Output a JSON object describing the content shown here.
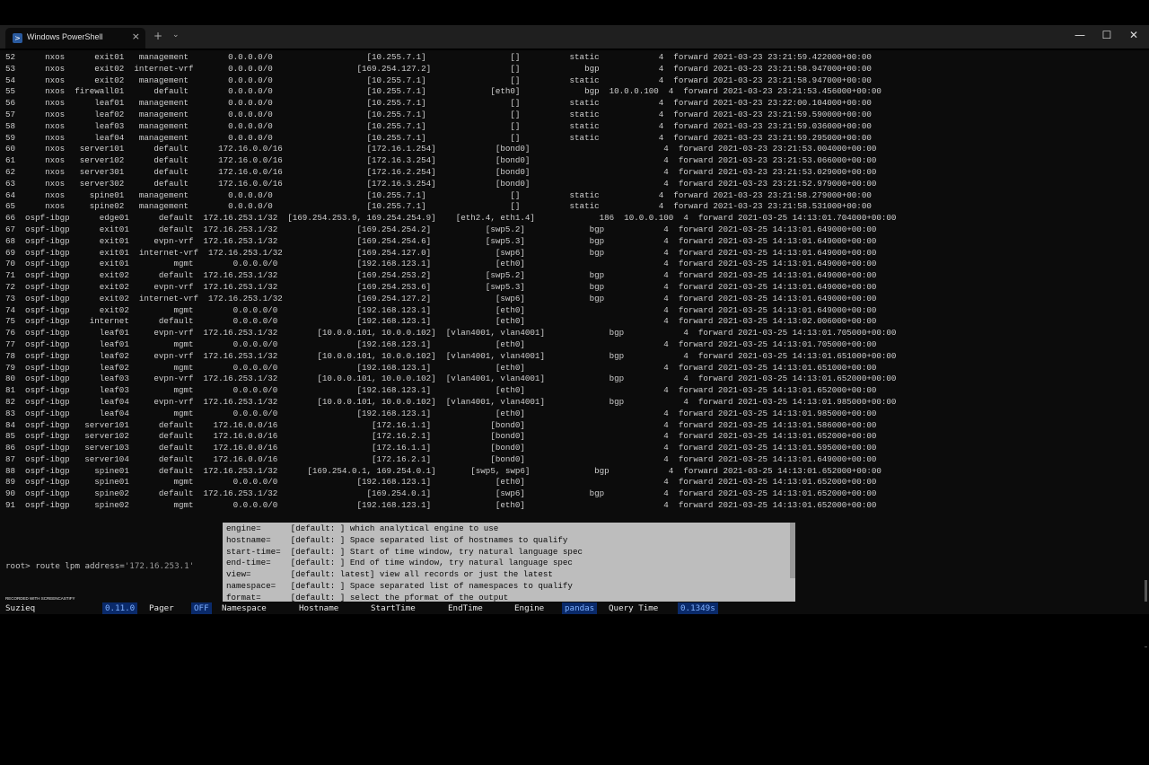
{
  "window": {
    "tab_title": "Windows PowerShell",
    "tab_close": "×",
    "new_tab": "+",
    "dropdown": "⌄",
    "minimize": "—",
    "maximize": "☐",
    "close": "✕"
  },
  "terminal_lines": [
    "52      nxos      exit01   management        0.0.0.0/0                   [10.255.7.1]                 []          static            4  forward 2021-03-23 23:21:59.422000+00:00",
    "53      nxos      exit02  internet-vrf       0.0.0.0/0                 [169.254.127.2]                []             bgp            4  forward 2021-03-23 23:21:58.947000+00:00",
    "54      nxos      exit02   management        0.0.0.0/0                   [10.255.7.1]                 []          static            4  forward 2021-03-23 23:21:58.947000+00:00",
    "55      nxos  firewall01      default        0.0.0.0/0                   [10.255.7.1]             [eth0]             bgp  10.0.0.100  4  forward 2021-03-23 23:21:53.456000+00:00",
    "56      nxos      leaf01   management        0.0.0.0/0                   [10.255.7.1]                 []          static            4  forward 2021-03-23 23:22:00.104000+00:00",
    "57      nxos      leaf02   management        0.0.0.0/0                   [10.255.7.1]                 []          static            4  forward 2021-03-23 23:21:59.590000+00:00",
    "58      nxos      leaf03   management        0.0.0.0/0                   [10.255.7.1]                 []          static            4  forward 2021-03-23 23:21:59.036000+00:00",
    "59      nxos      leaf04   management        0.0.0.0/0                   [10.255.7.1]                 []          static            4  forward 2021-03-23 23:21:59.295000+00:00",
    "60      nxos   server101      default      172.16.0.0/16                 [172.16.1.254]            [bond0]                           4  forward 2021-03-23 23:21:53.004000+00:00",
    "61      nxos   server102      default      172.16.0.0/16                 [172.16.3.254]            [bond0]                           4  forward 2021-03-23 23:21:53.066000+00:00",
    "62      nxos   server301      default      172.16.0.0/16                 [172.16.2.254]            [bond0]                           4  forward 2021-03-23 23:21:53.029000+00:00",
    "63      nxos   server302      default      172.16.0.0/16                 [172.16.3.254]            [bond0]                           4  forward 2021-03-23 23:21:52.979000+00:00",
    "64      nxos     spine01   management        0.0.0.0/0                   [10.255.7.1]                 []          static            4  forward 2021-03-23 23:21:58.279000+00:00",
    "65      nxos     spine02   management        0.0.0.0/0                   [10.255.7.1]                 []          static            4  forward 2021-03-23 23:21:58.531000+00:00",
    "66  ospf-ibgp      edge01      default  172.16.253.1/32  [169.254.253.9, 169.254.254.9]    [eth2.4, eth1.4]             186  10.0.0.100  4  forward 2021-03-25 14:13:01.704000+00:00",
    "67  ospf-ibgp      exit01      default  172.16.253.1/32                [169.254.254.2]           [swp5.2]             bgp            4  forward 2021-03-25 14:13:01.649000+00:00",
    "68  ospf-ibgp      exit01     evpn-vrf  172.16.253.1/32                [169.254.254.6]           [swp5.3]             bgp            4  forward 2021-03-25 14:13:01.649000+00:00",
    "69  ospf-ibgp      exit01  internet-vrf  172.16.253.1/32               [169.254.127.0]             [swp6]             bgp            4  forward 2021-03-25 14:13:01.649000+00:00",
    "70  ospf-ibgp      exit01         mgmt        0.0.0.0/0                [192.168.123.1]             [eth0]                            4  forward 2021-03-25 14:13:01.649000+00:00",
    "71  ospf-ibgp      exit02      default  172.16.253.1/32                [169.254.253.2]           [swp5.2]             bgp            4  forward 2021-03-25 14:13:01.649000+00:00",
    "72  ospf-ibgp      exit02     evpn-vrf  172.16.253.1/32                [169.254.253.6]           [swp5.3]             bgp            4  forward 2021-03-25 14:13:01.649000+00:00",
    "73  ospf-ibgp      exit02  internet-vrf  172.16.253.1/32               [169.254.127.2]             [swp6]             bgp            4  forward 2021-03-25 14:13:01.649000+00:00",
    "74  ospf-ibgp      exit02         mgmt        0.0.0.0/0                [192.168.123.1]             [eth0]                            4  forward 2021-03-25 14:13:01.649000+00:00",
    "75  ospf-ibgp    internet      default        0.0.0.0/0                [192.168.123.1]             [eth0]                            4  forward 2021-03-25 14:13:02.006000+00:00",
    "76  ospf-ibgp      leaf01     evpn-vrf  172.16.253.1/32        [10.0.0.101, 10.0.0.102]  [vlan4001, vlan4001]             bgp            4  forward 2021-03-25 14:13:01.705000+00:00",
    "77  ospf-ibgp      leaf01         mgmt        0.0.0.0/0                [192.168.123.1]             [eth0]                            4  forward 2021-03-25 14:13:01.705000+00:00",
    "78  ospf-ibgp      leaf02     evpn-vrf  172.16.253.1/32        [10.0.0.101, 10.0.0.102]  [vlan4001, vlan4001]             bgp            4  forward 2021-03-25 14:13:01.651000+00:00",
    "79  ospf-ibgp      leaf02         mgmt        0.0.0.0/0                [192.168.123.1]             [eth0]                            4  forward 2021-03-25 14:13:01.651000+00:00",
    "80  ospf-ibgp      leaf03     evpn-vrf  172.16.253.1/32        [10.0.0.101, 10.0.0.102]  [vlan4001, vlan4001]             bgp            4  forward 2021-03-25 14:13:01.652000+00:00",
    "81  ospf-ibgp      leaf03         mgmt        0.0.0.0/0                [192.168.123.1]             [eth0]                            4  forward 2021-03-25 14:13:01.652000+00:00",
    "82  ospf-ibgp      leaf04     evpn-vrf  172.16.253.1/32        [10.0.0.101, 10.0.0.102]  [vlan4001, vlan4001]             bgp            4  forward 2021-03-25 14:13:01.985000+00:00",
    "83  ospf-ibgp      leaf04         mgmt        0.0.0.0/0                [192.168.123.1]             [eth0]                            4  forward 2021-03-25 14:13:01.985000+00:00",
    "84  ospf-ibgp   server101      default    172.16.0.0/16                   [172.16.1.1]            [bond0]                            4  forward 2021-03-25 14:13:01.586000+00:00",
    "85  ospf-ibgp   server102      default    172.16.0.0/16                   [172.16.2.1]            [bond0]                            4  forward 2021-03-25 14:13:01.652000+00:00",
    "86  ospf-ibgp   server103      default    172.16.0.0/16                   [172.16.1.1]            [bond0]                            4  forward 2021-03-25 14:13:01.595000+00:00",
    "87  ospf-ibgp   server104      default    172.16.0.0/16                   [172.16.2.1]            [bond0]                            4  forward 2021-03-25 14:13:01.649000+00:00",
    "88  ospf-ibgp     spine01      default  172.16.253.1/32      [169.254.0.1, 169.254.0.1]       [swp5, swp6]             bgp            4  forward 2021-03-25 14:13:01.652000+00:00",
    "89  ospf-ibgp     spine01         mgmt        0.0.0.0/0                [192.168.123.1]             [eth0]                            4  forward 2021-03-25 14:13:01.652000+00:00",
    "90  ospf-ibgp     spine02      default  172.16.253.1/32                  [169.254.0.1]             [swp6]             bgp            4  forward 2021-03-25 14:13:01.652000+00:00",
    "91  ospf-ibgp     spine02         mgmt        0.0.0.0/0                [192.168.123.1]             [eth0]                            4  forward 2021-03-25 14:13:01.652000+00:00"
  ],
  "prompt": {
    "text": "root> route lpm address=",
    "arg": "'172.16.253.1'"
  },
  "completions": [
    "engine=      [default: ] which analytical engine to use",
    "hostname=    [default: ] Space separated list of hostnames to qualify",
    "start-time=  [default: ] Start of time window, try natural language spec",
    "end-time=    [default: ] End of time window, try natural language spec",
    "view=        [default: latest] view all records or just the latest",
    "namespace=   [default: ] Space separated list of namespaces to qualify",
    "format=      [default: ] select the pformat of the output"
  ],
  "status": {
    "app": "Suzieq",
    "version": "0.11.0",
    "pager_label": "Pager",
    "pager_value": "OFF",
    "namespace": "Namespace",
    "hostname": "Hostname",
    "start_time": "StartTime",
    "end_time": "EndTime",
    "engine_label": "Engine",
    "engine_value": "pandas",
    "query_label": "Query Time",
    "query_value": "0.1349s"
  },
  "recorder": "RECORDED WITH SCREENCASTIFY"
}
